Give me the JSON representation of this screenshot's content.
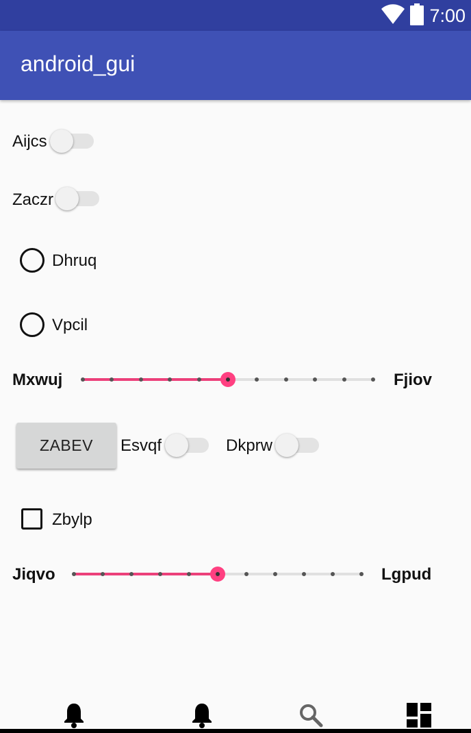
{
  "status_bar": {
    "time": "7:00",
    "icons": [
      "wifi-icon",
      "battery-icon"
    ]
  },
  "app_bar": {
    "title": "android_gui"
  },
  "switches": [
    {
      "label": "Aijcs",
      "checked": false
    },
    {
      "label": "Zaczr",
      "checked": false
    },
    {
      "label": "Esvqf",
      "checked": false
    },
    {
      "label": "Dkprw",
      "checked": false
    }
  ],
  "radios": [
    {
      "label": "Dhruq",
      "checked": false
    },
    {
      "label": "Vpcil",
      "checked": false
    }
  ],
  "sliders": [
    {
      "left_label": "Mxwuj",
      "right_label": "Fjiov",
      "steps": 10,
      "value": 5
    },
    {
      "left_label": "Jiqvo",
      "right_label": "Lgpud",
      "steps": 10,
      "value": 5
    }
  ],
  "button": {
    "label": "ZABEV"
  },
  "checkbox": {
    "label": "Zbylp",
    "checked": false
  },
  "bottom_nav": {
    "items": [
      {
        "icon": "bell-icon"
      },
      {
        "icon": "bell-icon"
      },
      {
        "icon": "search-icon"
      },
      {
        "icon": "dashboard-icon"
      }
    ]
  },
  "colors": {
    "status_bar": "#303f9f",
    "app_bar": "#3f51b5",
    "accent": "#ff4081",
    "background": "#fafafa"
  }
}
